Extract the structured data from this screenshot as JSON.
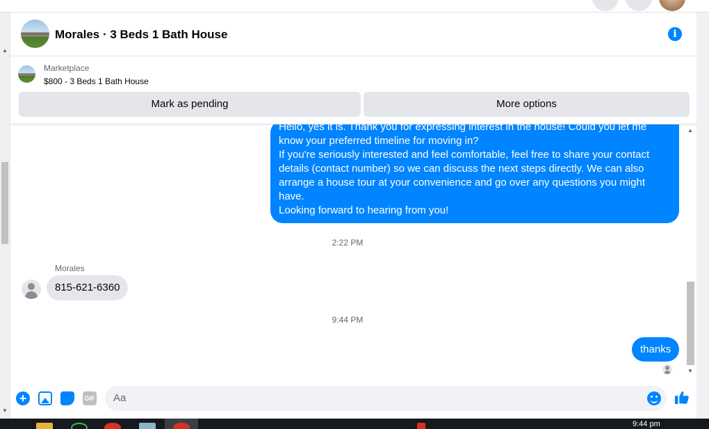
{
  "conversation": {
    "title": "Morales · 3 Beds 1 Bath House",
    "colors": {
      "accent": "#0084ff",
      "bubble_in": "#e4e6eb"
    }
  },
  "listing": {
    "label": "Marketplace",
    "item": "$800 - 3 Beds 1 Bath House"
  },
  "actions": {
    "mark_pending": "Mark as pending",
    "more_options": "More options"
  },
  "messages": {
    "outgoing_long": [
      "Hello, yes it is. Thank you for expressing interest in the house! Could you let me know your preferred timeline for moving in?",
      "If you're seriously interested and feel comfortable, feel free to share your contact details (contact number) so we can discuss the next steps directly. We can also arrange a house tour at your convenience and go over any questions you might have.",
      "Looking forward to hearing from you!"
    ],
    "time_1": "2:22 PM",
    "sender_name": "Morales",
    "incoming_phone": "815-621-6360",
    "time_2": "9:44 PM",
    "outgoing_thanks": "thanks"
  },
  "composer": {
    "placeholder": "Aa",
    "gif_label": "GIF"
  },
  "taskbar": {
    "clock": "9:44 pm"
  }
}
